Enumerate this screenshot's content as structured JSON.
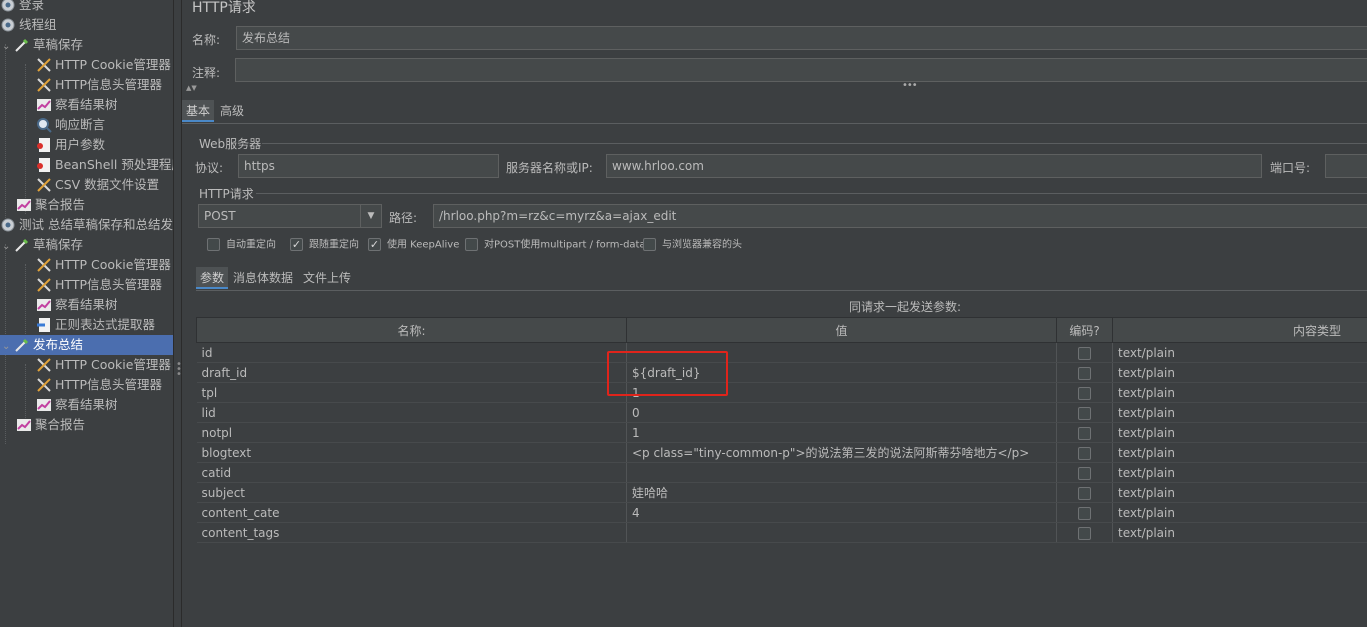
{
  "tree": [
    {
      "label": "登录",
      "icon": "gear-icon"
    },
    {
      "label": "线程组",
      "icon": "gear-icon"
    },
    {
      "label": "草稿保存",
      "icon": "pipette-icon"
    },
    {
      "label": "HTTP Cookie管理器",
      "icon": "wrench-icon"
    },
    {
      "label": "HTTP信息头管理器",
      "icon": "wrench-icon"
    },
    {
      "label": "察看结果树",
      "icon": "graph-icon"
    },
    {
      "label": "响应断言",
      "icon": "magnifier-icon"
    },
    {
      "label": "用户参数",
      "icon": "preprocessor-icon"
    },
    {
      "label": "BeanShell 预处理程序",
      "icon": "preprocessor-icon"
    },
    {
      "label": "CSV 数据文件设置",
      "icon": "wrench-icon"
    },
    {
      "label": "聚合报告",
      "icon": "graph-icon"
    },
    {
      "label": "测试 总结草稿保存和总结发布",
      "icon": "gear-icon"
    },
    {
      "label": "草稿保存",
      "icon": "pipette-icon"
    },
    {
      "label": "HTTP Cookie管理器",
      "icon": "wrench-icon"
    },
    {
      "label": "HTTP信息头管理器",
      "icon": "wrench-icon"
    },
    {
      "label": "察看结果树",
      "icon": "graph-icon"
    },
    {
      "label": "正则表达式提取器",
      "icon": "extractor-icon"
    },
    {
      "label": "发布总结",
      "icon": "pipette-icon"
    },
    {
      "label": "HTTP Cookie管理器",
      "icon": "wrench-icon"
    },
    {
      "label": "HTTP信息头管理器",
      "icon": "wrench-icon"
    },
    {
      "label": "察看结果树",
      "icon": "graph-icon"
    },
    {
      "label": "聚合报告",
      "icon": "graph-icon"
    }
  ],
  "panel": {
    "title": "HTTP请求",
    "name_label": "名称:",
    "name_value": "发布总结",
    "comment_label": "注释:",
    "comment_value": ""
  },
  "tabs": {
    "basic": "基本",
    "advanced": "高级"
  },
  "web_server": {
    "group_title": "Web服务器",
    "protocol_label": "协议:",
    "protocol_value": "https",
    "server_label": "服务器名称或IP:",
    "server_value": "www.hrloo.com",
    "port_label": "端口号:",
    "port_value": ""
  },
  "http_request": {
    "group_title": "HTTP请求",
    "method": "POST",
    "path_label": "路径:",
    "path_value": "/hrloo.php?m=rz&c=myrz&a=ajax_edit"
  },
  "options": [
    {
      "label": "自动重定向",
      "checked": false
    },
    {
      "label": "跟随重定向",
      "checked": true
    },
    {
      "label": "使用 KeepAlive",
      "checked": true
    },
    {
      "label": "对POST使用multipart / form-data",
      "checked": false
    },
    {
      "label": "与浏览器兼容的头",
      "checked": false
    }
  ],
  "sub_tabs": {
    "params": "参数",
    "body": "消息体数据",
    "files": "文件上传"
  },
  "params_caption": "同请求一起发送参数:",
  "table_headers": {
    "name": "名称:",
    "value": "值",
    "encode": "编码?",
    "content_type": "内容类型"
  },
  "rows": [
    {
      "name": "id",
      "value": "",
      "type": "text/plain"
    },
    {
      "name": "draft_id",
      "value": "${draft_id}",
      "type": "text/plain"
    },
    {
      "name": "tpl",
      "value": "1",
      "type": "text/plain"
    },
    {
      "name": "lid",
      "value": "0",
      "type": "text/plain"
    },
    {
      "name": "notpl",
      "value": "1",
      "type": "text/plain"
    },
    {
      "name": "blogtext",
      "value": "<p class=\"tiny-common-p\">的说法第三发的说法阿斯蒂芬啥地方</p>",
      "type": "text/plain"
    },
    {
      "name": "catid",
      "value": "",
      "type": "text/plain"
    },
    {
      "name": "subject",
      "value": "娃哈哈",
      "type": "text/plain"
    },
    {
      "name": "content_cate",
      "value": "4",
      "type": "text/plain"
    },
    {
      "name": "content_tags",
      "value": "",
      "type": "text/plain"
    }
  ],
  "colors": {
    "selection": "#4b6eaf",
    "accent_tab": "#4a88c7",
    "highlight_box": "#e0241b",
    "background": "#3c3f41"
  }
}
